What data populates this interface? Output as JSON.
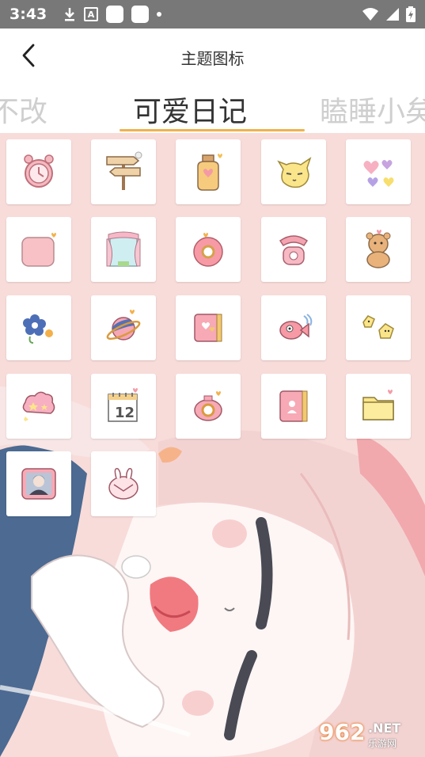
{
  "status_bar": {
    "time": "3:43",
    "icons": [
      "download-icon",
      "app-a-icon",
      "white-square-icon",
      "white-square-icon",
      "dot-icon",
      "wifi-icon",
      "signal-icon",
      "battery-icon"
    ]
  },
  "header": {
    "title": "主题图标",
    "back_icon": "chevron-left-icon"
  },
  "tabs": {
    "prev": "心不改",
    "active": "可爱日记",
    "next": "瞌睡小矣",
    "accent_color": "#f0b24b"
  },
  "icons": [
    {
      "name": "alarm-clock-icon"
    },
    {
      "name": "signpost-icon"
    },
    {
      "name": "jar-icon"
    },
    {
      "name": "cat-face-icon"
    },
    {
      "name": "hearts-icon"
    },
    {
      "name": "pink-square-icon"
    },
    {
      "name": "window-curtain-icon"
    },
    {
      "name": "donut-icon"
    },
    {
      "name": "telephone-icon"
    },
    {
      "name": "bear-icon"
    },
    {
      "name": "flower-icon"
    },
    {
      "name": "planet-icon"
    },
    {
      "name": "notebook-icon"
    },
    {
      "name": "fish-icon"
    },
    {
      "name": "chicks-icon"
    },
    {
      "name": "cloud-stars-icon"
    },
    {
      "name": "calendar-icon"
    },
    {
      "name": "camera-icon"
    },
    {
      "name": "contact-book-icon"
    },
    {
      "name": "folder-icon"
    },
    {
      "name": "photo-portrait-icon"
    },
    {
      "name": "bunny-mail-icon"
    }
  ],
  "watermark": {
    "number": "962",
    "net": ".NET",
    "sub": "乐游网"
  }
}
